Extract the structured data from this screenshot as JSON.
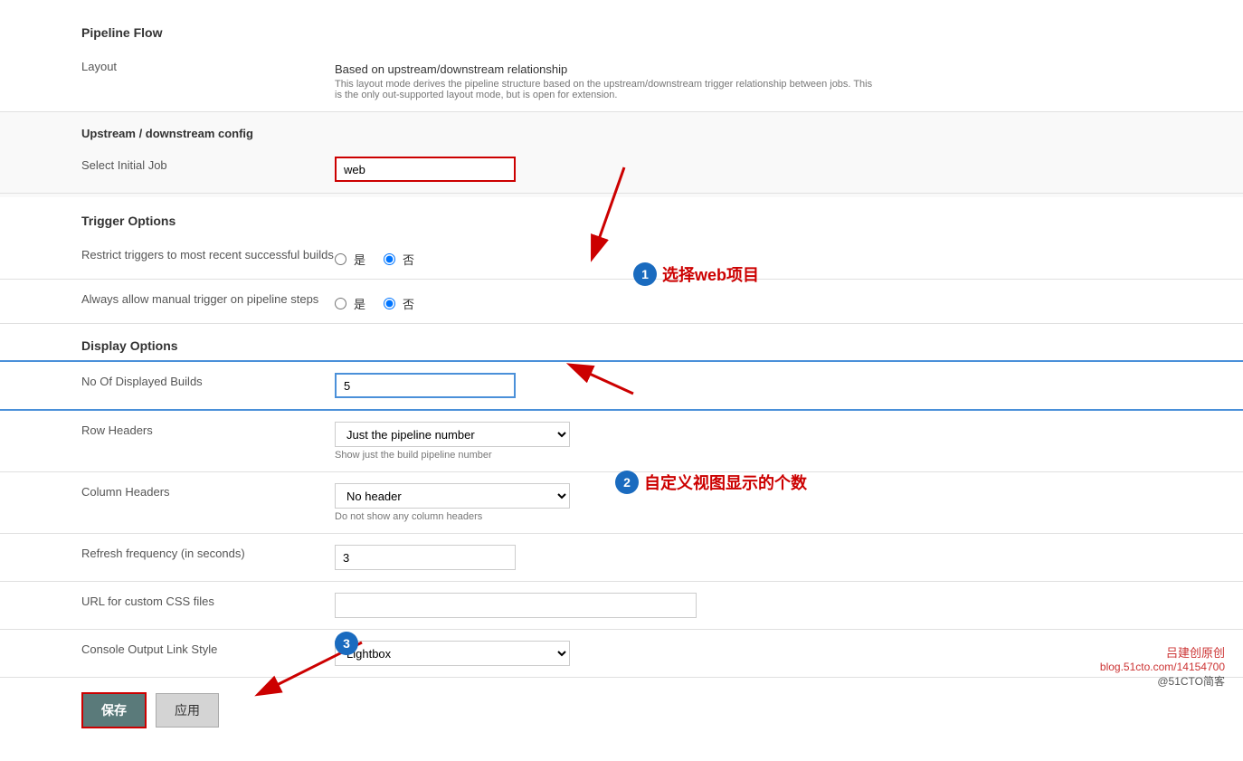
{
  "sections": {
    "pipeline_flow": {
      "title": "Pipeline Flow",
      "layout_label": "Layout",
      "layout_value": "Based on upstream/downstream relationship",
      "layout_hint": "This layout mode derives the pipeline structure based on the upstream/downstream trigger relationship between jobs. This is the only out-supported layout mode, but is open for extension.",
      "upstream_config_title": "Upstream / downstream config",
      "select_initial_job_label": "Select Initial Job",
      "select_initial_job_value": "web"
    },
    "trigger_options": {
      "title": "Trigger Options",
      "restrict_label": "Restrict triggers to most recent successful builds",
      "restrict_yes": "是",
      "restrict_no": "否",
      "restrict_value": "no",
      "always_allow_label": "Always allow manual trigger on pipeline steps",
      "always_allow_yes": "是",
      "always_allow_no": "否",
      "always_allow_value": "no"
    },
    "display_options": {
      "title": "Display Options",
      "no_of_builds_label": "No Of Displayed Builds",
      "no_of_builds_value": "5",
      "row_headers_label": "Row Headers",
      "row_headers_value": "Just the pipeline number",
      "row_headers_hint": "Show just the build pipeline number",
      "column_headers_label": "Column Headers",
      "column_headers_value": "No header",
      "column_headers_hint": "Do not show any column headers",
      "refresh_label": "Refresh frequency (in seconds)",
      "refresh_value": "3",
      "css_url_label": "URL for custom CSS files",
      "css_url_value": "",
      "console_link_label": "Console Output Link Style",
      "console_link_value": "Lightbox"
    }
  },
  "buttons": {
    "save_label": "保存",
    "apply_label": "应用"
  },
  "annotations": {
    "callout1_number": "1",
    "callout1_text": "选择web项目",
    "callout2_number": "2",
    "callout2_text": "自定义视图显示的个数",
    "callout3_number": "3"
  },
  "watermark": {
    "line1": "吕建创原创",
    "line2": "blog.51cto.com/14154700",
    "line3": "@51CTO简客"
  }
}
